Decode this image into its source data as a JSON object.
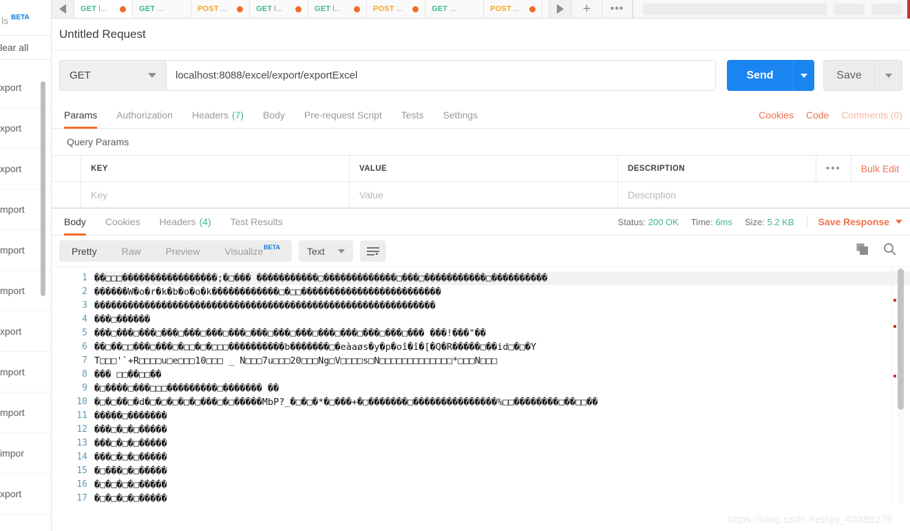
{
  "sidebar": {
    "header_label": "ls",
    "header_badge": "BETA",
    "clear_all": "lear all",
    "items": [
      {
        "label": "xport"
      },
      {
        "label": "xport"
      },
      {
        "label": "xport"
      },
      {
        "label": "mport"
      },
      {
        "label": "mport"
      },
      {
        "label": "mport"
      },
      {
        "label": "xport"
      },
      {
        "label": "mport"
      },
      {
        "label": "mport"
      },
      {
        "label": "impor"
      },
      {
        "label": "xport"
      }
    ]
  },
  "tabstrip": {
    "tabs": [
      {
        "method": "GET",
        "name": "l...",
        "dirty": true
      },
      {
        "method": "GET",
        "name": "...",
        "dirty": false
      },
      {
        "method": "POST",
        "name": "...",
        "dirty": true
      },
      {
        "method": "GET",
        "name": "l...",
        "dirty": true
      },
      {
        "method": "GET",
        "name": "l...",
        "dirty": true
      },
      {
        "method": "POST",
        "name": "...",
        "dirty": true
      },
      {
        "method": "GET",
        "name": "...",
        "dirty": false
      },
      {
        "method": "POST",
        "name": "...",
        "dirty": true
      }
    ],
    "new_tab_label": "+",
    "more_label": "•••"
  },
  "request": {
    "title": "Untitled Request",
    "method": "GET",
    "url": "localhost:8088/excel/export/exportExcel",
    "send_label": "Send",
    "save_label": "Save",
    "tabs": [
      {
        "label": "Params",
        "count": "",
        "active": true
      },
      {
        "label": "Authorization",
        "count": "",
        "active": false
      },
      {
        "label": "Headers",
        "count": "(7)",
        "active": false
      },
      {
        "label": "Body",
        "count": "",
        "active": false
      },
      {
        "label": "Pre-request Script",
        "count": "",
        "active": false
      },
      {
        "label": "Tests",
        "count": "",
        "active": false
      },
      {
        "label": "Settings",
        "count": "",
        "active": false
      }
    ],
    "cookies_link": "Cookies",
    "code_link": "Code",
    "comments_link": "Comments (0)"
  },
  "query_params": {
    "section_title": "Query Params",
    "columns": [
      "KEY",
      "VALUE",
      "DESCRIPTION"
    ],
    "more_label": "•••",
    "bulk_edit_label": "Bulk Edit",
    "rows": [
      {
        "key_placeholder": "Key",
        "value_placeholder": "Value",
        "description_placeholder": "Description"
      }
    ]
  },
  "response": {
    "tabs": [
      {
        "label": "Body",
        "count": "",
        "active": true
      },
      {
        "label": "Cookies",
        "count": "",
        "active": false
      },
      {
        "label": "Headers",
        "count": "(4)",
        "active": false
      },
      {
        "label": "Test Results",
        "count": "",
        "active": false
      }
    ],
    "status_label": "Status:",
    "status_value": "200 OK",
    "time_label": "Time:",
    "time_value": "6ms",
    "size_label": "Size:",
    "size_value": "5.2 KB",
    "save_response_label": "Save Response",
    "viewer": {
      "modes": [
        {
          "label": "Pretty",
          "active": true,
          "badge": ""
        },
        {
          "label": "Raw",
          "active": false,
          "badge": ""
        },
        {
          "label": "Preview",
          "active": false,
          "badge": ""
        },
        {
          "label": "Visualize",
          "active": false,
          "badge": "BETA"
        }
      ],
      "format": "Text",
      "copy_icon": "copy-icon",
      "search_icon": "search-icon",
      "wrap_icon": "wrap-lines-icon"
    },
    "body_lines": [
      {
        "n": "1",
        "text": "��□□□�����������������;�□���    �����������□�������������□���□�����������□����������"
      },
      {
        "n": "2",
        "text": "������W�o�r�k�b�o�o�k������������□�□□�������������������������"
      },
      {
        "n": "3",
        "text": "�������������������������������������������������������������"
      },
      {
        "n": "4",
        "text": "���□������"
      },
      {
        "n": "5",
        "text": "���□���□���□���□���□���□���□���□���□���□���□���□���□���□���  ���!���\"��"
      },
      {
        "n": "6",
        "text": "��□��□□���□���□�□□�□�□□□����������b�������□�eàaøs�y�p�oî�î�[�Q�R�����□��id□�□�Y"
      },
      {
        "n": "7",
        "text": "T□□□'`+R□□□□u□e□□□10□□□ _    N□□□7u□□□20□□□Ng□V□□□□s□N□□□□□□□□□□□□□*□□□N□□□"
      },
      {
        "n": "8",
        "text": "��� □□��□□��"
      },
      {
        "n": "9",
        "text": "�□����□���□□□���������□������� ��"
      },
      {
        "n": "10",
        "text": "�□�□��□�d�□�□�□�□�□���□�□�����MbP?_�□�□�*�□���+�□�������□���������������%□□��������□��□□��"
      },
      {
        "n": "11",
        "text": "�����□�������"
      },
      {
        "n": "12",
        "text": "���□�□�□�����"
      },
      {
        "n": "13",
        "text": "���□�□�□�����"
      },
      {
        "n": "14",
        "text": "���□�□�□�����"
      },
      {
        "n": "15",
        "text": "�□���□�□�����"
      },
      {
        "n": "16",
        "text": "�□�□�□�□�����"
      },
      {
        "n": "17",
        "text": "�□�□�□�□�����"
      }
    ]
  },
  "watermark": "https://blog.csdn.net/qq_40389276",
  "colors": {
    "accent_orange": "#f06c28",
    "send_blue": "#1a84f0",
    "get_green": "#41b883",
    "post_yellow": "#f5a623",
    "beta_blue": "#0d7de0"
  }
}
